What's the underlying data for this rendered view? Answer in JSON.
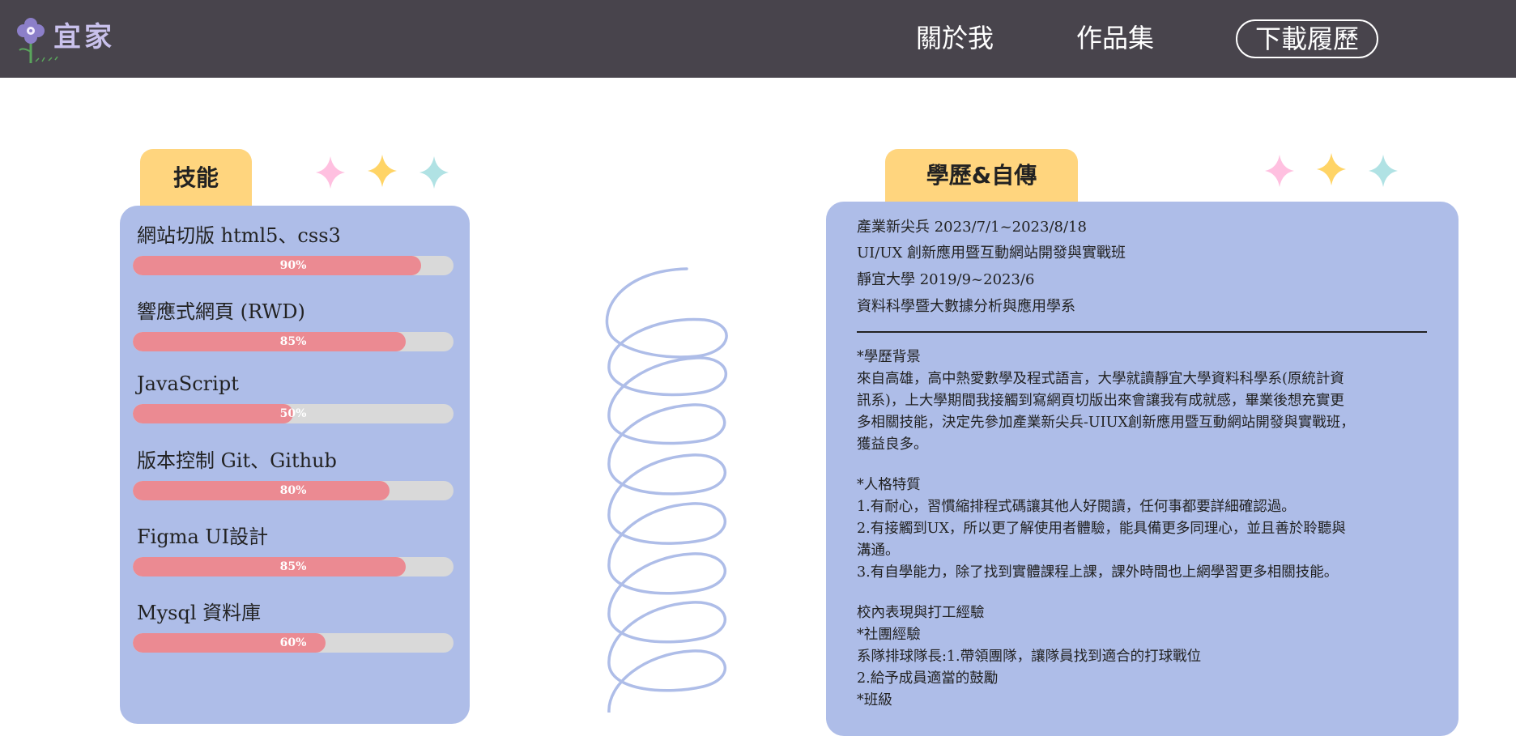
{
  "nav": {
    "about": "關於我",
    "works": "作品集",
    "resume": "下載履歷"
  },
  "logo": {
    "text": "宜家"
  },
  "skills": {
    "tab_label": "技能",
    "items": [
      {
        "name": "網站切版 html5、css3",
        "percent": 90,
        "label": "90%"
      },
      {
        "name": "響應式網頁 (RWD)",
        "percent": 85,
        "label": "85%"
      },
      {
        "name": "JavaScript",
        "percent": 50,
        "label": "50%"
      },
      {
        "name": "版本控制 Git、Github",
        "percent": 80,
        "label": "80%"
      },
      {
        "name": "Figma UI設計",
        "percent": 85,
        "label": "85%"
      },
      {
        "name": "Mysql 資料庫",
        "percent": 60,
        "label": "60%"
      }
    ]
  },
  "education": {
    "tab_label": "學歷&自傳",
    "lines": [
      "產業新尖兵 2023/7/1~2023/8/18",
      "UI/UX 創新應用暨互動網站開發與實戰班",
      "靜宜大學 2019/9~2023/6",
      "資料科學暨大數據分析與應用學系"
    ],
    "bio": [
      "*學歷背景",
      "來自高雄，高中熱愛數學及程式語言，大學就讀靜宜大學資料科學系(原統計資",
      "訊系)，上大學期間我接觸到寫網頁切版出來會讓我有成就感，畢業後想充實更",
      "多相關技能，決定先參加產業新尖兵-UIUX創新應用暨互動網站開發與實戰班，",
      "獲益良多。",
      "",
      "*人格特質",
      "1.有耐心，習慣縮排程式碼讓其他人好閱讀，任何事都要詳細確認過。",
      "2.有接觸到UX，所以更了解使用者體驗，能具備更多同理心，並且善於聆聽與",
      "溝通。",
      "3.有自學能力，除了找到實體課程上課，課外時間也上網學習更多相關技能。",
      "",
      "校內表現與打工經驗",
      "*社團經驗",
      "系隊排球隊長:1.帶領團隊，讓隊員找到適合的打球戰位",
      "2.給予成員適當的鼓勵",
      "*班級"
    ]
  },
  "colors": {
    "header_bg": "#48444c",
    "panel_bg": "#aebde8",
    "tab_bg": "#ffd57e",
    "bar_fill": "#eb8a92",
    "bar_track": "#d9d9d9",
    "sparkle_pink": "#ffc0e0",
    "sparkle_yellow": "#ffd466",
    "sparkle_teal": "#b0e2e4",
    "spiral": "#aebde8"
  }
}
